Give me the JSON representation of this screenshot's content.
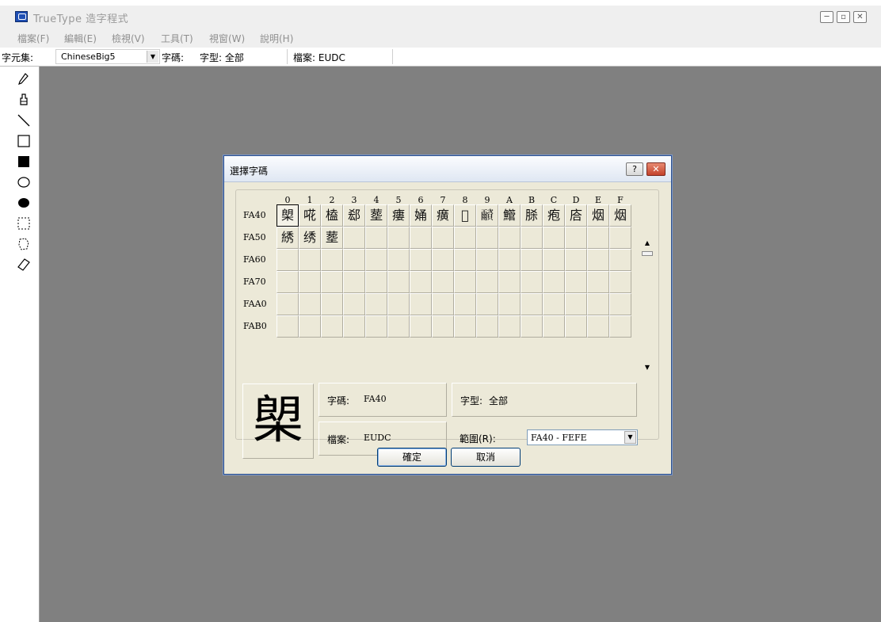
{
  "app": {
    "title": "TrueType 造字程式"
  },
  "window_controls": {
    "minimize": "─",
    "restore": "▫",
    "close": "✕"
  },
  "menu": [
    "檔案(F)",
    "編輯(E)",
    "檢視(V)",
    "工具(T)",
    "視窗(W)",
    "說明(H)"
  ],
  "status": {
    "charset_label": "字元集:",
    "charset_value": "ChineseBig5",
    "code_label": "字碼:",
    "font_label": "字型: 全部",
    "file_label": "檔案: EUDC"
  },
  "tools": [
    "pencil-icon",
    "brush-icon",
    "line-icon",
    "hollow-rectangle-icon",
    "filled-rectangle-icon",
    "hollow-ellipse-icon",
    "filled-ellipse-icon",
    "rectangular-selection-icon",
    "freeform-selection-icon",
    "eraser-icon"
  ],
  "dialog": {
    "title": "選擇字碼",
    "help": "?",
    "close": "✕",
    "col_headers": [
      "0",
      "1",
      "2",
      "3",
      "4",
      "5",
      "6",
      "7",
      "8",
      "9",
      "A",
      "B",
      "C",
      "D",
      "E",
      "F"
    ],
    "rows": [
      {
        "label": "FA40",
        "cells": [
          "㮾",
          "𠵅",
          "榼",
          "郄",
          "塟",
          "瘻",
          "㛚",
          "癀",
          "𦶜",
          "𩆂",
          "䲘",
          "脎",
          "疱",
          "𢈈",
          "烟",
          "烟"
        ]
      },
      {
        "label": "FA50",
        "cells": [
          "綉",
          "绣",
          "塟",
          "",
          "",
          "",
          "",
          "",
          "",
          "",
          "",
          "",
          "",
          "",
          "",
          ""
        ]
      },
      {
        "label": "FA60",
        "cells": [
          "",
          "",
          "",
          "",
          "",
          "",
          "",
          "",
          "",
          "",
          "",
          "",
          "",
          "",
          "",
          ""
        ]
      },
      {
        "label": "FA70",
        "cells": [
          "",
          "",
          "",
          "",
          "",
          "",
          "",
          "",
          "",
          "",
          "",
          "",
          "",
          "",
          "",
          ""
        ]
      },
      {
        "label": "FAA0",
        "cells": [
          "",
          "",
          "",
          "",
          "",
          "",
          "",
          "",
          "",
          "",
          "",
          "",
          "",
          "",
          "",
          ""
        ]
      },
      {
        "label": "FAB0",
        "cells": [
          "",
          "",
          "",
          "",
          "",
          "",
          "",
          "",
          "",
          "",
          "",
          "",
          "",
          "",
          "",
          ""
        ]
      }
    ],
    "preview_char": "㮾",
    "code_label": "字碼:",
    "code_value": "FA40",
    "font_label": "字型:",
    "font_value": "全部",
    "file_label": "檔案:",
    "file_value": "EUDC",
    "range_label": "範圍(R):",
    "range_value": "FA40 - FEFE",
    "ok": "確定",
    "cancel": "取消"
  }
}
